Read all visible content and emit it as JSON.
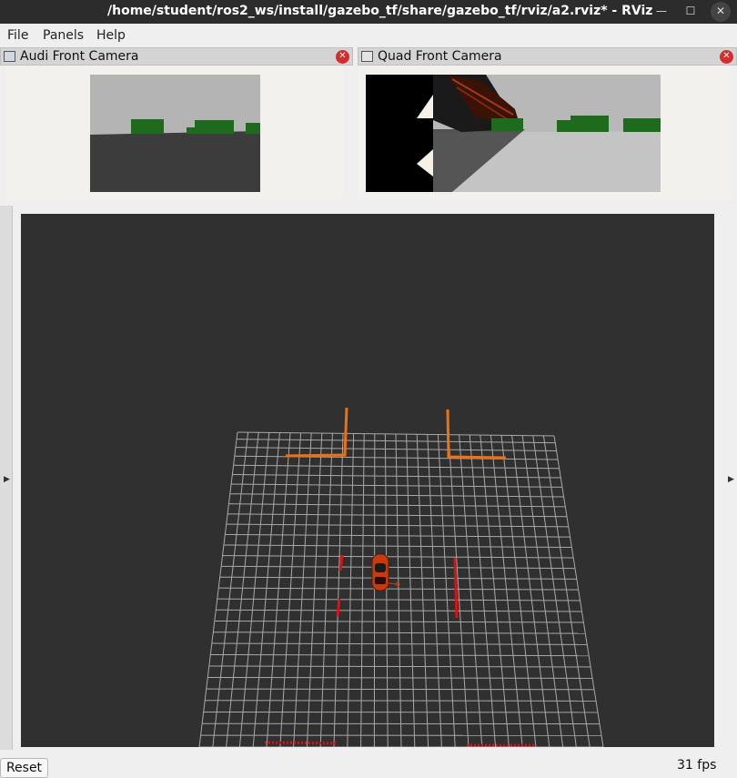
{
  "window": {
    "title": "/home/student/ros2_ws/install/gazebo_tf/share/gazebo_tf/rviz/a2.rviz* - RViz",
    "minimize_glyph": "—",
    "maximize_glyph": "☐",
    "close_glyph": "✕"
  },
  "menu": {
    "file": "File",
    "panels": "Panels",
    "help": "Help"
  },
  "panels": {
    "audi": {
      "title": "Audi Front Camera",
      "icon": "image-icon"
    },
    "quad": {
      "title": "Quad Front Camera",
      "icon": "camera-icon"
    },
    "close_glyph": "✕"
  },
  "colors": {
    "viewport_bg": "#303030",
    "grid": "#a8a8a8",
    "marker_orange": "#f07010",
    "marker_red": "#e01010",
    "tree_green": "#1e6b1e",
    "sky_gray": "#b4b4b4"
  },
  "status": {
    "reset_label": "Reset",
    "fps": "31 fps"
  }
}
